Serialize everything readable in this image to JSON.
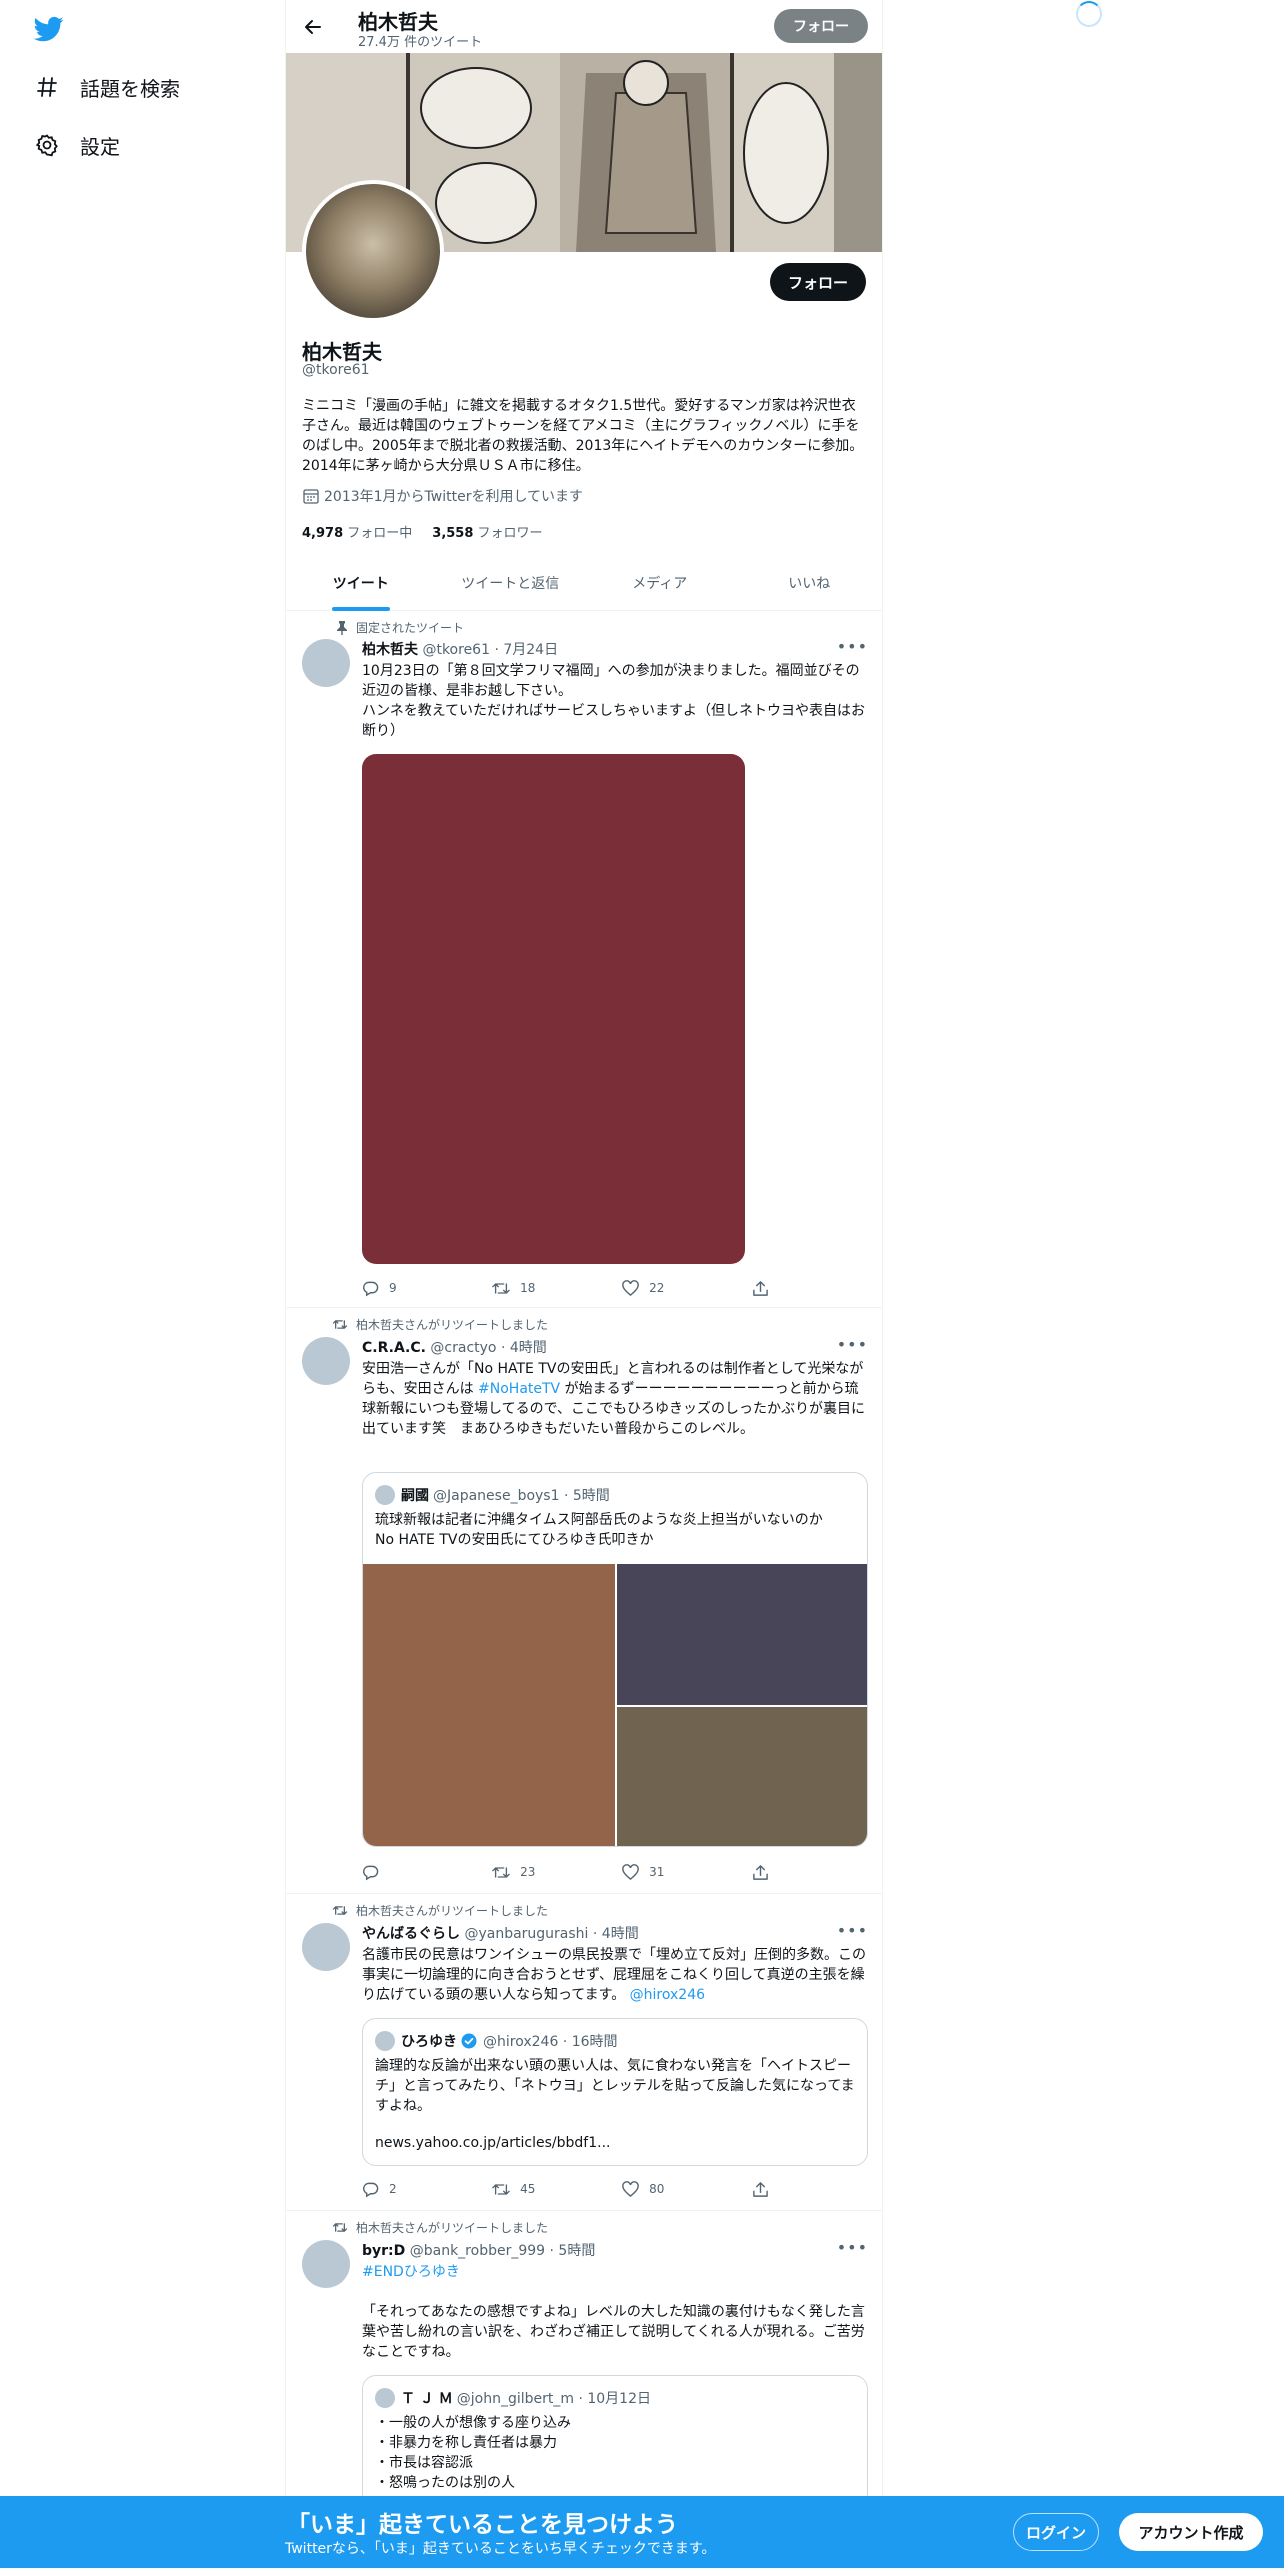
{
  "sidebar": {
    "items": [
      {
        "label": "話題を検索",
        "icon": "hashtag-icon"
      },
      {
        "label": "設定",
        "icon": "gear-icon"
      }
    ]
  },
  "header": {
    "name": "柏木哲夫",
    "tweet_count": "27.4万 件のツイート",
    "follow_label": "フォロー"
  },
  "profile": {
    "name": "柏木哲夫",
    "handle": "@tkore61",
    "follow_label": "フォロー",
    "bio": "ミニコミ「漫画の手帖」に雑文を掲載するオタク1.5世代。愛好するマンガ家は衿沢世衣子さん。最近は韓国のウェブトゥーンを経てアメコミ（主にグラフィックノベル）に手をのばし中。2005年まで脱北者の救援活動、2013年にヘイトデモへのカウンターに参加。2014年に茅ヶ崎から大分県ＵＳＡ市に移住。",
    "joined": "2013年1月からTwitterを利用しています",
    "following_count": "4,978",
    "following_label": "フォロー中",
    "followers_count": "3,558",
    "followers_label": "フォロワー"
  },
  "tabs": [
    "ツイート",
    "ツイートと返信",
    "メディア",
    "いいね"
  ],
  "tweets": [
    {
      "context": "固定されたツイート",
      "name": "柏木哲夫",
      "handle_time": "@tkore61 · 7月24日",
      "text": "10月23日の「第８回文学フリマ福岡」への参加が決まりました。福岡並びその近辺の皆様、是非お越し下さい。\nハンネを教えていただければサービスしちゃいますよ（但しネトウヨや表自はお断り）",
      "media_color": "#7a2f38",
      "replies": "9",
      "retweets": "18",
      "likes": "22"
    },
    {
      "context": "柏木哲夫さんがリツイートしました",
      "name": "C.R.A.C.",
      "handle_time": "@cractyo · 4時間",
      "text_before": "安田浩一さんが「No HATE TVの安田氏」と言われるのは制作者として光栄ながらも、安田さんは ",
      "hashtag": "#NoHateTV",
      "text_after": " が始まるずーーーーーーーーーーっと前から琉球新報にいつも登場してるので、ここでもひろゆきッズのしったかぶりが裏目に出ています笑　まあひろゆきもだいたい普段からこのレベル。",
      "quote": {
        "name": "嗣國",
        "handle_time": "@Japanese_boys1 · 5時間",
        "text": "琉球新報は記者に沖縄タイムス阿部岳氏のような炎上担当がいないのか\nNo HATE TVの安田氏にてひろゆき氏叩きか",
        "media_colors": [
          "#93644a",
          "#474557",
          "#706451"
        ]
      },
      "replies": "",
      "retweets": "23",
      "likes": "31"
    },
    {
      "context": "柏木哲夫さんがリツイートしました",
      "name": "やんばるぐらし",
      "handle_time": "@yanbarugurashi · 4時間",
      "text_before": "名護市民の民意はワンイシューの県民投票で「埋め立て反対」圧倒的多数。この事実に一切論理的に向き合おうとせず、屁理屈をこねくり回して真逆の主張を繰り広げている頭の悪い人なら知ってます。 ",
      "mention": "@hirox246",
      "quote": {
        "name": "ひろゆき",
        "handle_time": "@hirox246 · 16時間",
        "text": "論理的な反論が出来ない頭の悪い人は、気に食わない発言を「ヘイトスピーチ」と言ってみたり、「ネトウヨ」とレッテルを貼って反論した気になってますよね。",
        "link": "news.yahoo.co.jp/articles/bbdf1..."
      },
      "replies": "2",
      "retweets": "45",
      "likes": "80"
    },
    {
      "context": "柏木哲夫さんがリツイートしました",
      "name": "byr:D",
      "handle_time": "@bank_robber_999 · 5時間",
      "hashtag": "#ENDひろゆき",
      "text": "「それってあなたの感想ですよね」レベルの大した知識の裏付けもなく発した言葉や苦し紛れの言い訳を、わざわざ補正して説明してくれる人が現れる。ご苦労なことですね。",
      "quote": {
        "name": "Ｔ Ｊ Ｍ",
        "handle_time": "@john_gilbert_m · 10月12日",
        "lines": [
          "・一般の人が想像する座り込み",
          "・非暴力を称し責任者は暴力",
          "・市長は容認派",
          "・怒鳴ったのは別の人"
        ]
      }
    }
  ],
  "bottom_bar": {
    "title": "「いま」起きていることを見つけよう",
    "subtitle": "Twitterなら、「いま」起きていることをいち早くチェックできます。",
    "login": "ログイン",
    "signup": "アカウント作成"
  },
  "colors": {
    "accent": "#1d9bf0",
    "text": "#0f1419",
    "muted": "#536471"
  }
}
